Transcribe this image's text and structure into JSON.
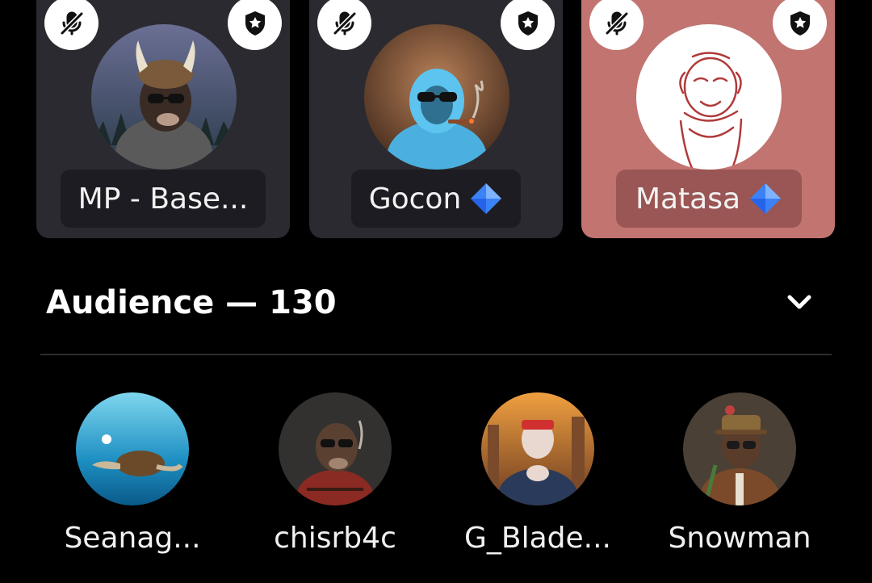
{
  "colors": {
    "background": "#000000",
    "card": "#2b2a30",
    "card_highlight": "#c27471",
    "pill": "#1d1c22",
    "pill_highlight": "#9a5654",
    "diamond": "#3b82f6"
  },
  "speakers": [
    {
      "name": "MP - Base...",
      "verified_icon": null,
      "muted_icon": "mic-muted-icon",
      "role_icon": "moderator-shield-icon",
      "speaking": false
    },
    {
      "name": "Gocon",
      "verified_icon": "diamond-icon",
      "muted_icon": "mic-muted-icon",
      "role_icon": "moderator-shield-icon",
      "speaking": false
    },
    {
      "name": "Matasa",
      "verified_icon": "diamond-icon",
      "muted_icon": "mic-muted-icon",
      "role_icon": "moderator-shield-icon",
      "speaking": true
    }
  ],
  "audience": {
    "title": "Audience — 130",
    "toggle_icon": "chevron-down-icon",
    "members": [
      {
        "name": "Seanag..."
      },
      {
        "name": "chisrb4c"
      },
      {
        "name": "G_Blade..."
      },
      {
        "name": "Snowman"
      }
    ]
  }
}
